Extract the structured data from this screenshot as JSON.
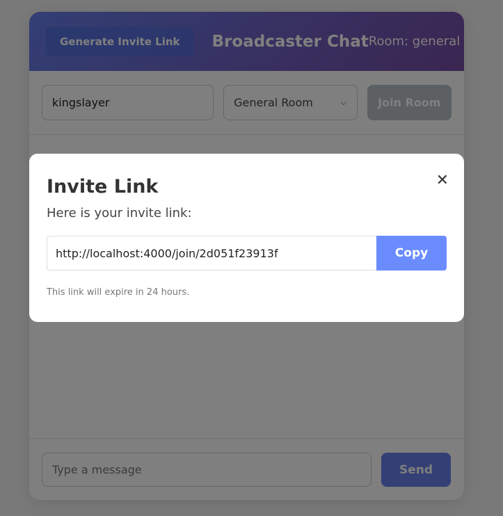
{
  "header": {
    "generate_label": "Generate Invite Link",
    "title": "Broadcaster Chat",
    "room": "Room: general"
  },
  "controls": {
    "username": "kingslayer",
    "room_select": "General Room",
    "join_label": "Join Room"
  },
  "footer": {
    "message_placeholder": "Type a message",
    "send_label": "Send"
  },
  "modal": {
    "title": "Invite Link",
    "description": "Here is your invite link:",
    "link": "http://localhost:4000/join/2d051f23913f",
    "copy_label": "Copy",
    "note": "This link will expire in 24 hours.",
    "close_glyph": "✕"
  },
  "colors": {
    "gradient_start": "#667eea",
    "gradient_end": "#764ba2",
    "copy": "#6b8cff"
  }
}
